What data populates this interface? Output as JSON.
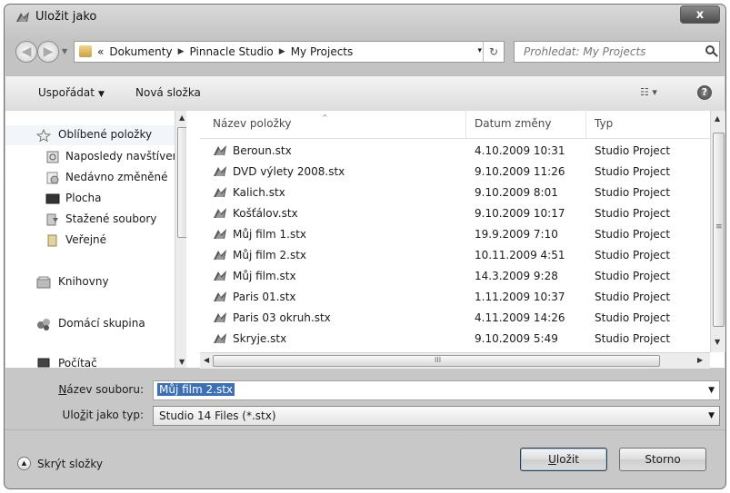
{
  "window": {
    "title": "Uložit jako",
    "close_label": "x"
  },
  "address": {
    "prefix": "«",
    "crumbs": [
      "Dokumenty",
      "Pinnacle Studio",
      "My Projects"
    ],
    "separator": "▶",
    "dropdown": "▾",
    "refresh": "↻"
  },
  "search": {
    "placeholder": "Prohledat: My Projects"
  },
  "toolbar": {
    "organize": "Uspořádat",
    "organize_arrow": "▼",
    "new_folder": "Nová složka",
    "views": "☷ ▾",
    "help": "?"
  },
  "nav": {
    "favorites": "Oblíbené položky",
    "items": [
      "Naposledy navštívené",
      "Nedávno změněné",
      "Plocha",
      "Stažené soubory",
      "Veřejné"
    ],
    "libraries": "Knihovny",
    "homegroup": "Domácí skupina",
    "computer": "Počítač"
  },
  "columns": {
    "name": "Název položky",
    "date": "Datum změny",
    "type": "Typ",
    "sort_caret": "^"
  },
  "files": [
    {
      "name": "Beroun.stx",
      "date": "4.10.2009 10:31",
      "type": "Studio Project"
    },
    {
      "name": "DVD výlety 2008.stx",
      "date": "9.10.2009 11:26",
      "type": "Studio Project"
    },
    {
      "name": "Kalich.stx",
      "date": "9.10.2009 8:01",
      "type": "Studio Project"
    },
    {
      "name": "Košťálov.stx",
      "date": "9.10.2009 10:17",
      "type": "Studio Project"
    },
    {
      "name": "Můj film 1.stx",
      "date": "19.9.2009 7:10",
      "type": "Studio Project"
    },
    {
      "name": "Můj film 2.stx",
      "date": "10.11.2009 4:51",
      "type": "Studio Project"
    },
    {
      "name": "Můj film.stx",
      "date": "14.3.2009 9:28",
      "type": "Studio Project"
    },
    {
      "name": "Paris 01.stx",
      "date": "1.11.2009 10:37",
      "type": "Studio Project"
    },
    {
      "name": "Paris 03 okruh.stx",
      "date": "4.11.2009 14:26",
      "type": "Studio Project"
    },
    {
      "name": "Skryje.stx",
      "date": "9.10.2009 5:49",
      "type": "Studio Project"
    }
  ],
  "filename": {
    "label_u": "N",
    "label_rest": "ázev souboru:",
    "value": "Můj film 2.stx"
  },
  "filetype": {
    "label_pre": "Ulo",
    "label_u": "ž",
    "label_rest": "it jako typ:",
    "value": "Studio 14 Files (*.stx)"
  },
  "footer": {
    "hide_folders": "Skrýt složky",
    "save_u": "U",
    "save_rest": "ložit",
    "cancel": "Storno"
  },
  "scroll": {
    "up": "▲",
    "down": "▼",
    "left": "◀",
    "right": "▶",
    "grip": "III",
    "grip_v": "≡"
  },
  "colors": {
    "selection": "#3d6fb5",
    "chrome": "#c8c8c8",
    "close_button": "#4a4a4a"
  }
}
